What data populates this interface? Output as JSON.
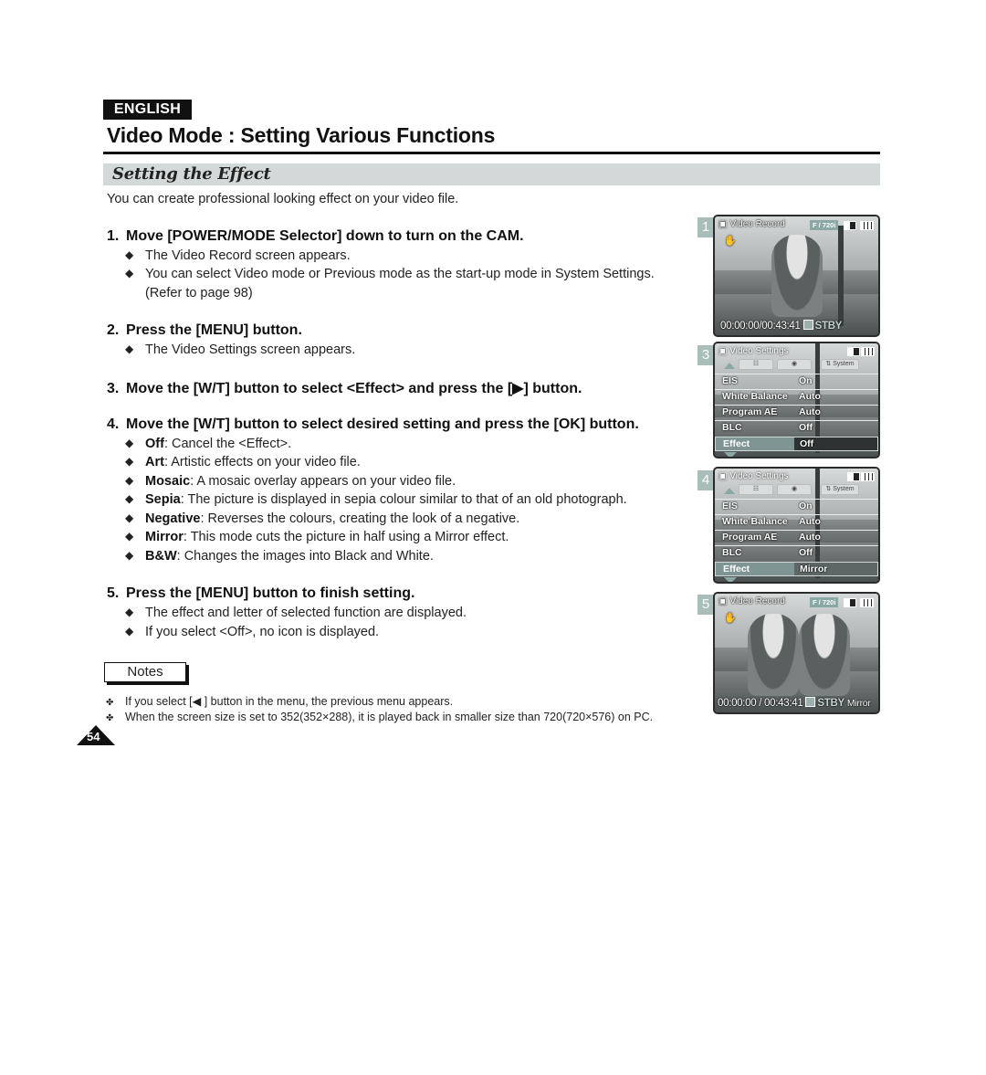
{
  "language_badge": "ENGLISH",
  "page_title": "Video Mode : Setting Various Functions",
  "section_title": "Setting the Effect",
  "intro": "You can create professional looking effect on your video file.",
  "steps": [
    {
      "num": "1.",
      "text": "Move [POWER/MODE Selector] down to turn on the CAM.",
      "bullets": [
        {
          "text": "The Video Record screen appears."
        },
        {
          "text": "You can select Video mode or Previous mode as the start-up mode in System Settings.",
          "cont": "(Refer to page 98)"
        }
      ]
    },
    {
      "num": "2.",
      "text": "Press the [MENU] button.",
      "bullets": [
        {
          "text": "The Video Settings screen appears."
        }
      ]
    },
    {
      "num": "3.",
      "text": "Move the [W/T] button to select <Effect> and press the [▶] button.",
      "bullets": []
    },
    {
      "num": "4.",
      "text": "Move the [W/T] button to select desired setting and press the [OK] button.",
      "bullets": [
        {
          "term": "Off",
          "text": ": Cancel the <Effect>."
        },
        {
          "term": "Art",
          "text": ": Artistic effects on your video file."
        },
        {
          "term": "Mosaic",
          "text": ": A mosaic overlay appears on your video file."
        },
        {
          "term": "Sepia",
          "text": ": The picture is displayed in sepia colour similar to that of an old photograph."
        },
        {
          "term": "Negative",
          "text": ": Reverses the colours, creating the look of a negative."
        },
        {
          "term": "Mirror",
          "text": ": This mode cuts the picture in half using a Mirror effect."
        },
        {
          "term": "B&W",
          "text": ": Changes the images into Black and White."
        }
      ]
    },
    {
      "num": "5.",
      "text": "Press the [MENU] button to finish setting.",
      "bullets": [
        {
          "text": "The effect and letter of selected function are displayed."
        },
        {
          "text": "If you select <Off>, no icon is displayed."
        }
      ]
    }
  ],
  "bullet_glyph": "◆",
  "notes": {
    "label": "Notes",
    "glyph": "✤",
    "items": [
      "If you select [◀ ] button in the menu, the previous menu appears.",
      "When the screen size is set to 352(352×288), it is played back in smaller size than 720(720×576) on PC."
    ]
  },
  "page_number": "54",
  "screens": {
    "s1": {
      "label": "1",
      "title": "Video Record",
      "quality_badge": "F / 720i",
      "mode_icon": "✋",
      "timecode": "00:00:00/00:43:41",
      "status": "STBY"
    },
    "s3": {
      "label": "3",
      "title": "Video Settings",
      "tabs": [
        "☷",
        "◉",
        "⇅ System"
      ],
      "rows": [
        {
          "key": "EIS",
          "value": "On"
        },
        {
          "key": "White Balance",
          "value": "Auto"
        },
        {
          "key": "Program AE",
          "value": "Auto"
        },
        {
          "key": "BLC",
          "value": "Off"
        },
        {
          "key": "Effect",
          "value": "Off"
        }
      ]
    },
    "s4": {
      "label": "4",
      "title": "Video Settings",
      "tabs": [
        "☷",
        "◉",
        "⇅ System"
      ],
      "rows": [
        {
          "key": "EIS",
          "value": "On"
        },
        {
          "key": "White Balance",
          "value": "Auto"
        },
        {
          "key": "Program AE",
          "value": "Auto"
        },
        {
          "key": "BLC",
          "value": "Off"
        },
        {
          "key": "Effect",
          "value": "Mirror"
        }
      ]
    },
    "s5": {
      "label": "5",
      "title": "Video Record",
      "quality_badge": "F / 720i",
      "mode_icon": "✋",
      "timecode": "00:00:00 / 00:43:41",
      "status": "STBY",
      "effect": "Mirror"
    }
  },
  "colors": {
    "section_bar": "#d3d9d9",
    "screen_accent": "#8aa8a6",
    "label_bg": "#a9bdbb"
  }
}
